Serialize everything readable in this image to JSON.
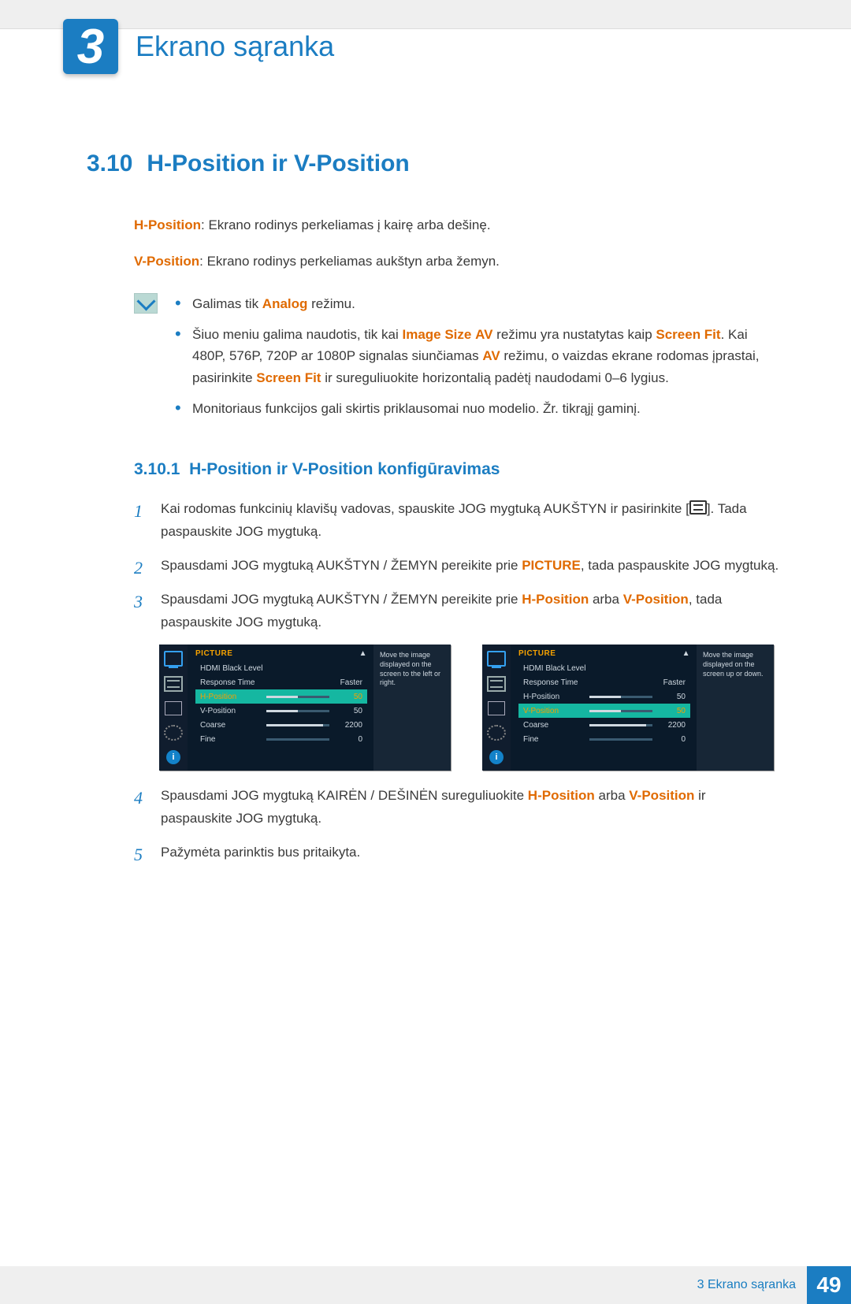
{
  "chapter": {
    "number": "3",
    "title": "Ekrano sąranka"
  },
  "section": {
    "number": "3.10",
    "title": "H-Position ir V-Position"
  },
  "intro": {
    "hpos_label": "H-Position",
    "hpos_text": ": Ekrano rodinys perkeliamas į kairę arba dešinę.",
    "vpos_label": "V-Position",
    "vpos_text": ": Ekrano rodinys perkeliamas aukštyn arba žemyn."
  },
  "notes": {
    "n1a": "Galimas tik ",
    "n1b": "Analog",
    "n1c": " režimu.",
    "n2a": "Šiuo meniu galima naudotis, tik kai ",
    "n2b": "Image Size",
    "n2c": " ",
    "n2d": "AV",
    "n2e": " režimu yra nustatytas kaip ",
    "n2f": "Screen Fit",
    "n2g": ". Kai 480P, 576P, 720P ar 1080P signalas siunčiamas ",
    "n2h": "AV",
    "n2i": " režimu, o vaizdas ekrane rodomas įprastai, pasirinkite ",
    "n2j": "Screen Fit",
    "n2k": " ir sureguliuokite horizontalią padėtį naudodami 0–6 lygius.",
    "n3": "Monitoriaus funkcijos gali skirtis priklausomai nuo modelio. Žr. tikrąjį gaminį."
  },
  "subsection": {
    "number": "3.10.1",
    "title": "H-Position ir V-Position konfigūravimas"
  },
  "steps": {
    "s1a": "Kai rodomas funkcinių klavišų vadovas, spauskite JOG mygtuką AUKŠTYN ir pasirinkite [",
    "s1b": "]. Tada paspauskite JOG mygtuką.",
    "s2a": "Spausdami JOG mygtuką AUKŠTYN / ŽEMYN pereikite prie ",
    "s2b": "PICTURE",
    "s2c": ", tada paspauskite JOG mygtuką.",
    "s3a": "Spausdami JOG mygtuką AUKŠTYN / ŽEMYN pereikite prie ",
    "s3b": "H-Position",
    "s3c": " arba ",
    "s3d": "V-Position",
    "s3e": ", tada paspauskite JOG mygtuką.",
    "s4a": "Spausdami JOG mygtuką KAIRĖN / DEŠINĖN sureguliuokite ",
    "s4b": "H-Position",
    "s4c": " arba ",
    "s4d": "V-Position",
    "s4e": " ir paspauskite JOG mygtuką.",
    "s5": "Pažymėta parinktis bus pritaikyta."
  },
  "osd": {
    "title": "PICTURE",
    "rows": {
      "hdmi": "HDMI Black Level",
      "resp": "Response Time",
      "resp_val": "Faster",
      "hpos": "H-Position",
      "hpos_val": "50",
      "vpos": "V-Position",
      "vpos_val": "50",
      "coarse": "Coarse",
      "coarse_val": "2200",
      "fine": "Fine",
      "fine_val": "0"
    },
    "tip_h": "Move the image displayed on the screen to the left or right.",
    "tip_v": "Move the image displayed on the screen up or down."
  },
  "footer": {
    "label": "3 Ekrano sąranka",
    "page": "49"
  }
}
